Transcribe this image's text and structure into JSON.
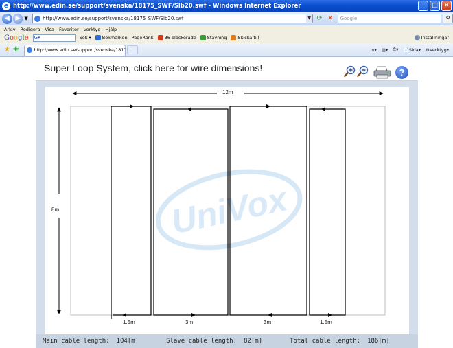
{
  "window": {
    "title": "http://www.edin.se/support/svenska/18175_SWF/Slb20.swf - Windows Internet Explorer",
    "buttons": {
      "minimize": "_",
      "maximize": "□",
      "close": "×"
    }
  },
  "address_bar": {
    "url": "http://www.edin.se/support/svenska/18175_SWF/Slb20.swf",
    "search_placeholder": "Google"
  },
  "menu": [
    "Arkiv",
    "Redigera",
    "Visa",
    "Favoriter",
    "Verktyg",
    "Hjälp"
  ],
  "google_toolbar": {
    "search_label": "Sök",
    "bookmarks": "Bokmärken",
    "pagerank": "PageRank",
    "blocked": "36 blockerade",
    "spelling": "Stavning",
    "send": "Skicka till",
    "settings": "Inställningar"
  },
  "tabs": {
    "active_label": "http://www.edin.se/support/svenska/18175_SWF/Slb...",
    "page_label": "Sida",
    "tools_label": "Verktyg"
  },
  "flash": {
    "header_link": "Super Loop System, click here for wire dimensions!",
    "help_glyph": "?",
    "watermark": "UniVox",
    "dimensions": {
      "width": "12m",
      "height": "8m",
      "columns": [
        "1.5m",
        "3m",
        "3m",
        "1.5m"
      ]
    },
    "footer": {
      "main_label": "Main cable length:",
      "main_value": "104[m]",
      "slave_label": "Slave cable length:",
      "slave_value": "82[m]",
      "total_label": "Total cable length:",
      "total_value": "186[m]"
    }
  },
  "colors": {
    "titlebar": "#0a4fd1",
    "flash_bg": "#d3deea",
    "footer_bg": "#c7d3e1",
    "watermark": "#d6e7f6"
  }
}
